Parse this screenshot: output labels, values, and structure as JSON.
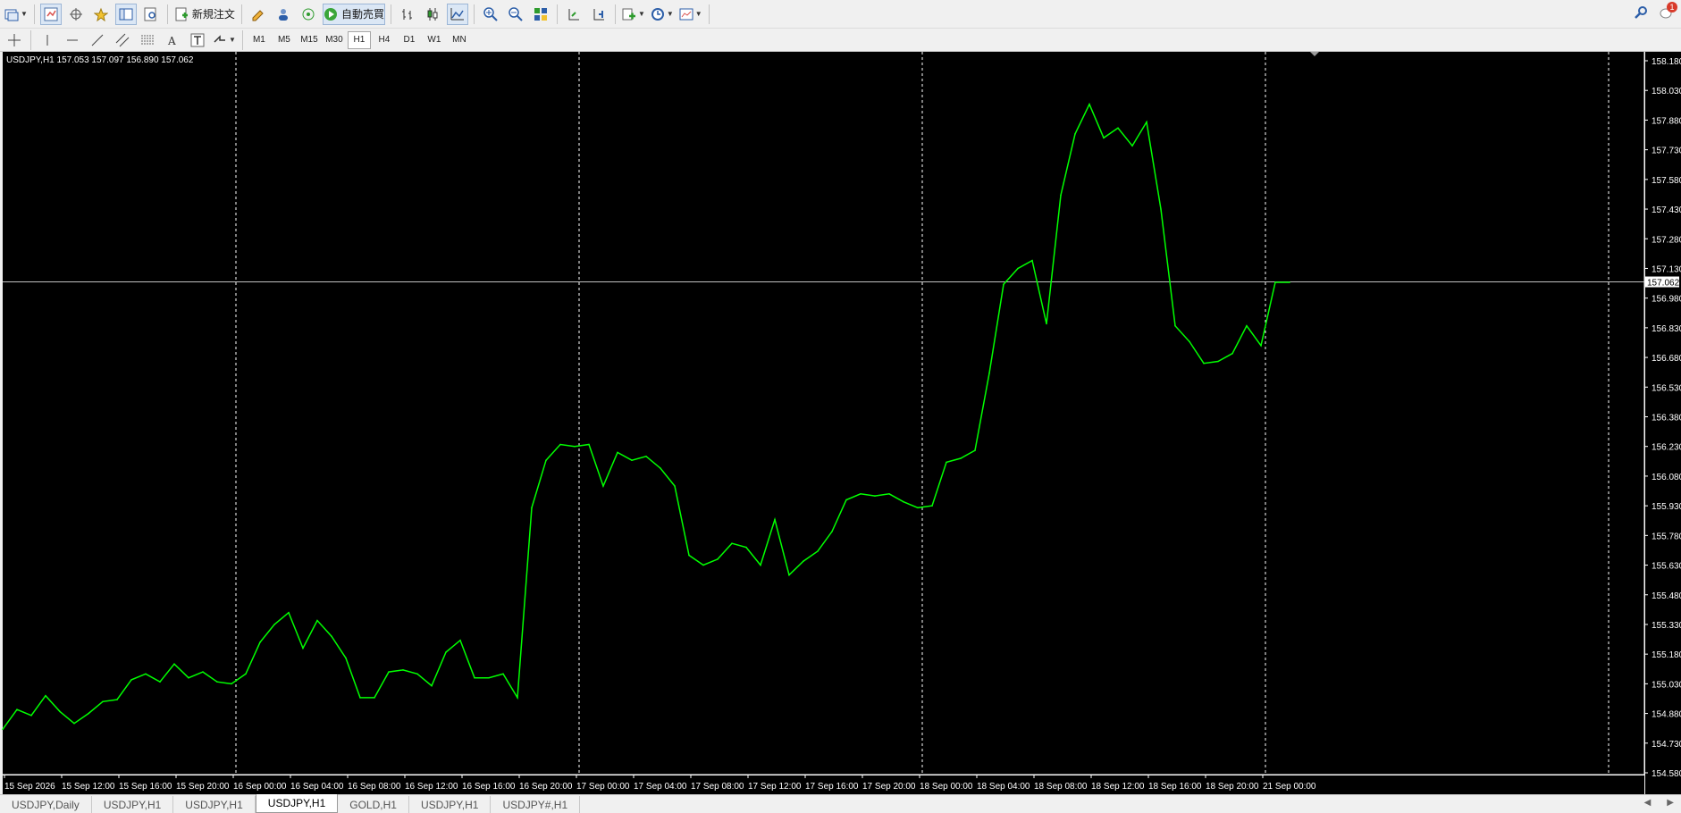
{
  "toolbar": {
    "new_order_label": "新規注文",
    "auto_trading_label": "自動売買",
    "notification_count": "1"
  },
  "timeframes": [
    "M1",
    "M5",
    "M15",
    "M30",
    "H1",
    "H4",
    "D1",
    "W1",
    "MN"
  ],
  "active_timeframe": "H1",
  "chart": {
    "header": "USDJPY,H1  157.053 157.097 156.890 157.062",
    "current_price_label": "157.062",
    "colors": {
      "background": "#000000",
      "line": "#00ff00",
      "grid": "#ffffff",
      "price_line": "#c0c0c0"
    }
  },
  "chart_data": {
    "type": "line",
    "symbol": "USDJPY",
    "timeframe": "H1",
    "ylim": [
      154.58,
      158.18
    ],
    "y_ticks": [
      "158.180",
      "158.030",
      "157.880",
      "157.730",
      "157.580",
      "157.430",
      "157.280",
      "157.130",
      "156.980",
      "156.830",
      "156.680",
      "156.530",
      "156.380",
      "156.230",
      "156.080",
      "155.930",
      "155.780",
      "155.630",
      "155.480",
      "155.330",
      "155.180",
      "155.030",
      "154.880",
      "154.730",
      "154.580"
    ],
    "x_ticks": [
      {
        "label": "15 Sep 2026",
        "bar": 0
      },
      {
        "label": "15 Sep 12:00",
        "bar": 4
      },
      {
        "label": "15 Sep 16:00",
        "bar": 8
      },
      {
        "label": "15 Sep 20:00",
        "bar": 12
      },
      {
        "label": "16 Sep 00:00",
        "bar": 16
      },
      {
        "label": "16 Sep 04:00",
        "bar": 20
      },
      {
        "label": "16 Sep 08:00",
        "bar": 24
      },
      {
        "label": "16 Sep 12:00",
        "bar": 28
      },
      {
        "label": "16 Sep 16:00",
        "bar": 32
      },
      {
        "label": "16 Sep 20:00",
        "bar": 36
      },
      {
        "label": "17 Sep 00:00",
        "bar": 40
      },
      {
        "label": "17 Sep 04:00",
        "bar": 44
      },
      {
        "label": "17 Sep 08:00",
        "bar": 48
      },
      {
        "label": "17 Sep 12:00",
        "bar": 52
      },
      {
        "label": "17 Sep 16:00",
        "bar": 56
      },
      {
        "label": "17 Sep 20:00",
        "bar": 60
      },
      {
        "label": "18 Sep 00:00",
        "bar": 64
      },
      {
        "label": "18 Sep 04:00",
        "bar": 68
      },
      {
        "label": "18 Sep 08:00",
        "bar": 72
      },
      {
        "label": "18 Sep 12:00",
        "bar": 76
      },
      {
        "label": "18 Sep 16:00",
        "bar": 80
      },
      {
        "label": "18 Sep 20:00",
        "bar": 84
      },
      {
        "label": "21 Sep 00:00",
        "bar": 88
      }
    ],
    "period_separator_bars": [
      16,
      40,
      64,
      88,
      112
    ],
    "current_price": 157.062,
    "series": [
      {
        "values": [
          154.8,
          154.9,
          154.87,
          154.97,
          154.89,
          154.83,
          154.88,
          154.94,
          154.95,
          155.05,
          155.08,
          155.04,
          155.13,
          155.06,
          155.09,
          155.04,
          155.03,
          155.08,
          155.24,
          155.33,
          155.39,
          155.21,
          155.35,
          155.27,
          155.16,
          154.96,
          154.96,
          155.09,
          155.1,
          155.08,
          155.02,
          155.19,
          155.25,
          155.06,
          155.06,
          155.08,
          154.96,
          155.92,
          156.16,
          156.24,
          156.23,
          156.24,
          156.03,
          156.2,
          156.16,
          156.18,
          156.12,
          156.03,
          155.68,
          155.63,
          155.66,
          155.74,
          155.72,
          155.63,
          155.86,
          155.58,
          155.65,
          155.7,
          155.8,
          155.96,
          155.99,
          155.98,
          155.99,
          155.95,
          155.92,
          155.93,
          156.15,
          156.17,
          156.21,
          156.6,
          157.05,
          157.13,
          157.17,
          156.85,
          157.5,
          157.81,
          157.96,
          157.79,
          157.84,
          157.75,
          157.87,
          157.43,
          156.84,
          156.76,
          156.65,
          156.66,
          156.7,
          156.84,
          156.74,
          157.06,
          157.06
        ]
      }
    ]
  },
  "tabs": [
    "USDJPY,Daily",
    "USDJPY,H1",
    "USDJPY,H1",
    "USDJPY,H1",
    "GOLD,H1",
    "USDJPY,H1",
    "USDJPY#,H1"
  ],
  "active_tab_index": 3
}
